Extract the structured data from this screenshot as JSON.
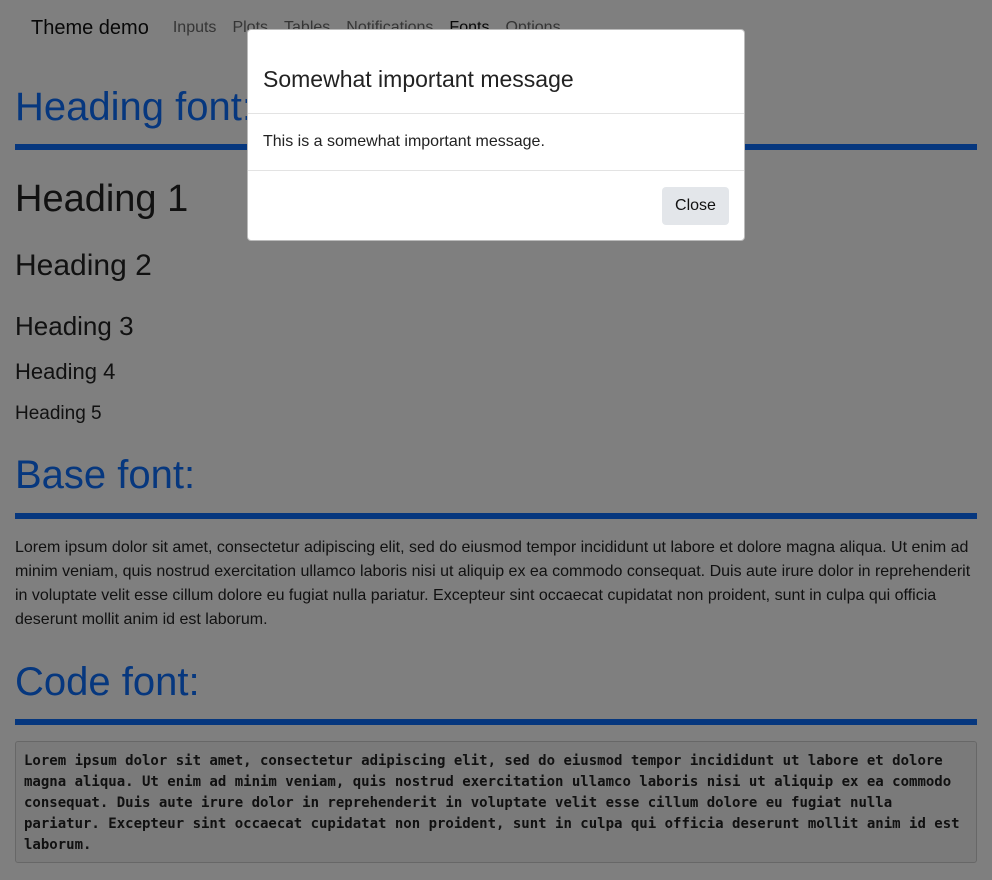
{
  "navbar": {
    "brand": "Theme demo",
    "items": [
      {
        "label": "Inputs",
        "active": false
      },
      {
        "label": "Plots",
        "active": false
      },
      {
        "label": "Tables",
        "active": false
      },
      {
        "label": "Notifications",
        "active": false
      },
      {
        "label": "Fonts",
        "active": true
      },
      {
        "label": "Options",
        "active": false
      }
    ]
  },
  "sections": {
    "heading_font": {
      "title": "Heading font:",
      "headings": [
        "Heading 1",
        "Heading 2",
        "Heading 3",
        "Heading 4",
        "Heading 5"
      ]
    },
    "base_font": {
      "title": "Base font:",
      "text": "Lorem ipsum dolor sit amet, consectetur adipiscing elit, sed do eiusmod tempor incididunt ut labore et dolore magna aliqua. Ut enim ad minim veniam, quis nostrud exercitation ullamco laboris nisi ut aliquip ex ea commodo consequat. Duis aute irure dolor in reprehenderit in voluptate velit esse cillum dolore eu fugiat nulla pariatur. Excepteur sint occaecat cupidatat non proident, sunt in culpa qui officia deserunt mollit anim id est laborum."
    },
    "code_font": {
      "title": "Code font:",
      "text": "Lorem ipsum dolor sit amet, consectetur adipiscing elit, sed do eiusmod tempor incididunt ut labore et dolore magna aliqua. Ut enim ad minim veniam, quis nostrud exercitation ullamco laboris nisi ut aliquip ex ea commodo consequat. Duis aute irure dolor in reprehenderit in voluptate velit esse cillum dolore eu fugiat nulla pariatur. Excepteur sint occaecat cupidatat non proident, sunt in culpa qui officia deserunt mollit anim id est laborum."
    }
  },
  "modal": {
    "title": "Somewhat important message",
    "body": "This is a somewhat important message.",
    "close_label": "Close"
  },
  "colors": {
    "accent": "#0d6efd",
    "backdrop": "rgba(0,0,0,0.5)",
    "button_bg": "#e3e6ea"
  }
}
